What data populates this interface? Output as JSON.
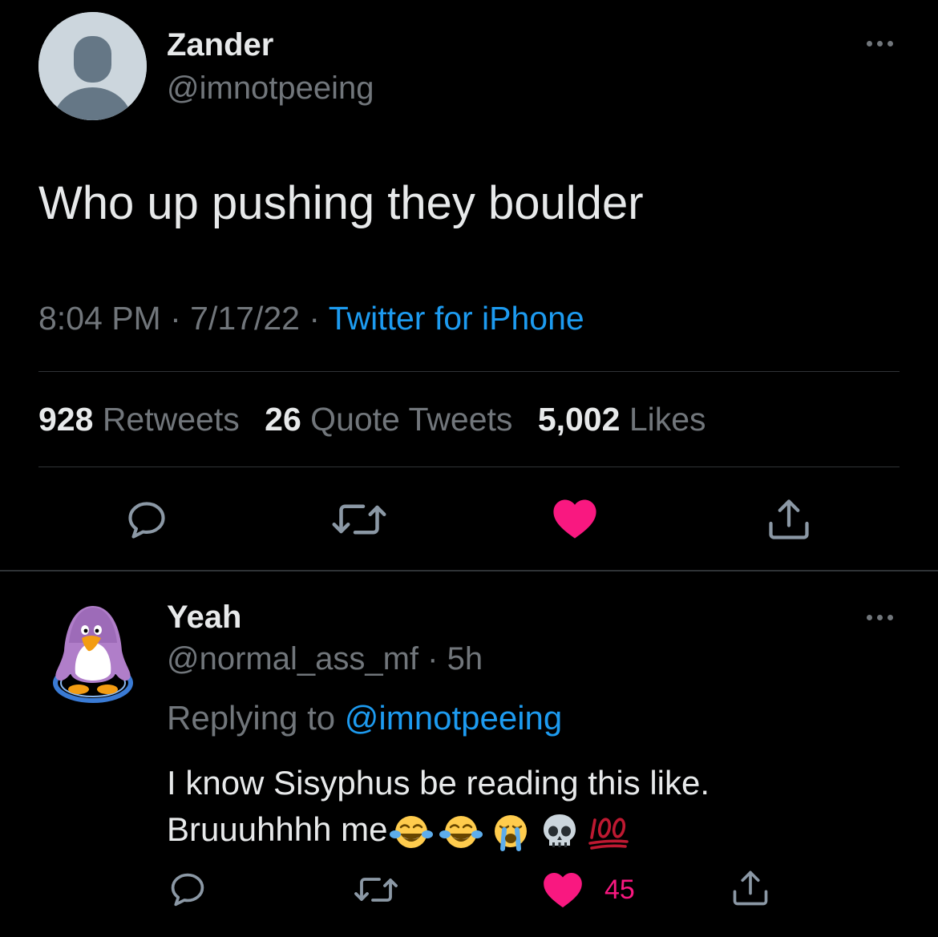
{
  "tweet": {
    "author_name": "Zander",
    "author_handle": "@imnotpeeing",
    "text": "Who up pushing they boulder",
    "time": "8:04 PM",
    "date": "7/17/22",
    "separator": "·",
    "source": "Twitter for iPhone",
    "stats": {
      "retweets_count": "928",
      "retweets_label": "Retweets",
      "quotes_count": "26",
      "quotes_label": "Quote Tweets",
      "likes_count": "5,002",
      "likes_label": "Likes"
    },
    "liked": true
  },
  "reply": {
    "author_name": "Yeah",
    "author_handle": "@normal_ass_mf",
    "age": "5h",
    "separator": "·",
    "replying_prefix": "Replying to",
    "replying_to": "@imnotpeeing",
    "text_line1": "I know Sisyphus be reading this like.",
    "text_line2": "Bruuuhhhh me",
    "emojis": [
      "face-with-tears-of-joy",
      "face-with-tears-of-joy",
      "loudly-crying-face",
      "skull",
      "hundred-points"
    ],
    "like_count": "45",
    "liked": true
  },
  "icons": {
    "reply": "reply-icon",
    "retweet": "retweet-icon",
    "like": "heart-icon",
    "share": "share-icon",
    "more": "more-icon"
  },
  "colors": {
    "background": "#000000",
    "text": "#e7e9ea",
    "secondary": "#71767b",
    "link": "#1d9bf0",
    "like": "#f91880",
    "divider": "#2f3336"
  }
}
